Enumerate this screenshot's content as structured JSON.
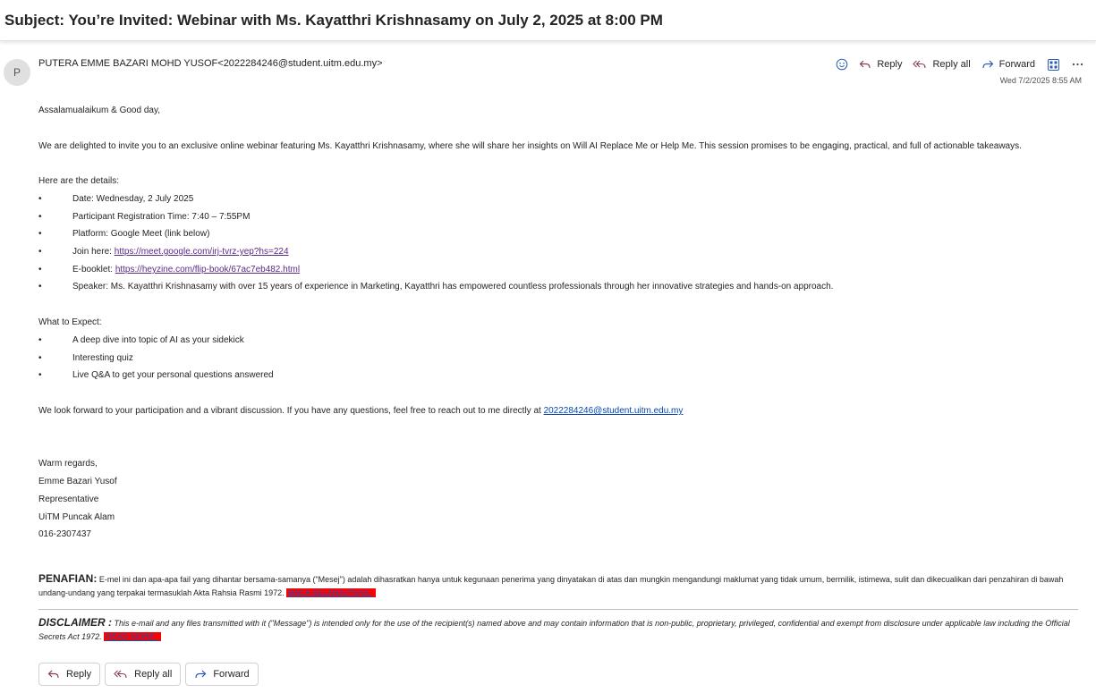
{
  "subject": "Subject: You’re Invited: Webinar with Ms. Kayatthri Krishnasamy on July 2, 2025 at 8:00 PM",
  "avatar_initial": "P",
  "sender": "PUTERA EMME BAZARI MOHD YUSOF<2022284246@student.uitm.edu.my>",
  "date": "Wed 7/2/2025 8:55 AM",
  "actions": {
    "reply": "Reply",
    "reply_all": "Reply all",
    "forward": "Forward"
  },
  "greeting": "Assalamualaikum & Good day,",
  "intro": "We are delighted to invite you to an exclusive online webinar featuring Ms. Kayatthri Krishnasamy, where she will share her insights on Will AI Replace Me or Help Me. This session promises to be engaging, practical, and full of actionable takeaways.",
  "details_heading": "Here are the details:",
  "bullet_char": "•",
  "details": {
    "date": "Date: Wednesday, 2 July 2025",
    "registration": "Participant Registration Time: 7:40 – 7:55PM",
    "platform": "Platform: Google Meet (link below)",
    "join_label": "Join here: ",
    "join_link": "https://meet.google.com/irj-tvrz-yep?hs=224",
    "ebook_label": "E-booklet: ",
    "ebook_link": "https://heyzine.com/flip-book/67ac7eb482.html",
    "speaker": "Speaker: Ms. Kayatthri Krishnasamy with over 15 years of experience in Marketing, Kayatthri has empowered countless professionals through her innovative strategies and hands-on approach."
  },
  "expect_heading": "What to Expect:",
  "expect": [
    "A deep dive into topic of AI as your sidekick",
    "Interesting quiz",
    "Live Q&A to get your personal questions answered"
  ],
  "closing": "We look forward to your participation and a vibrant discussion. If you have any questions, feel free to reach out to me directly at ",
  "closing_email": "2022284246@student.uitm.edu.my",
  "signature": [
    "Warm regards,",
    "Emme Bazari Yusof",
    "Representative",
    "UiTM Puncak Alam",
    "016-2307437"
  ],
  "penafian_head": "PENAFIAN:",
  "penafian_text": " E-mel ini dan apa-apa fail yang dihantar bersama-samanya (\"Mesej\") adalah dihasratkan hanya untuk kegunaan penerima yang dinyatakan di atas dan mungkin mengandungi maklumat yang tidak umum, bermilik, istimewa, sulit dan dikecualikan dari penzahiran di bawah undang-undang yang terpakai termasuklah Akta Rahsia Rasmi 1972. ",
  "penafian_link": "BACA SELANJUTNYA..",
  "disclaimer_head": "DISCLAIMER :",
  "disclaimer_text": " This e-mail and any files transmitted with it (\"Message\") is intended only for the use of the recipient(s) named above and may contain information that is non-public,  proprietary,  privileged,  confidential  and  exempt  from  disclosure under applicable law including the Official Secrets Act 1972. ",
  "disclaimer_link": "READ MORE..",
  "buttons": {
    "reply": "Reply",
    "reply_all": "Reply all",
    "forward": "Forward"
  }
}
